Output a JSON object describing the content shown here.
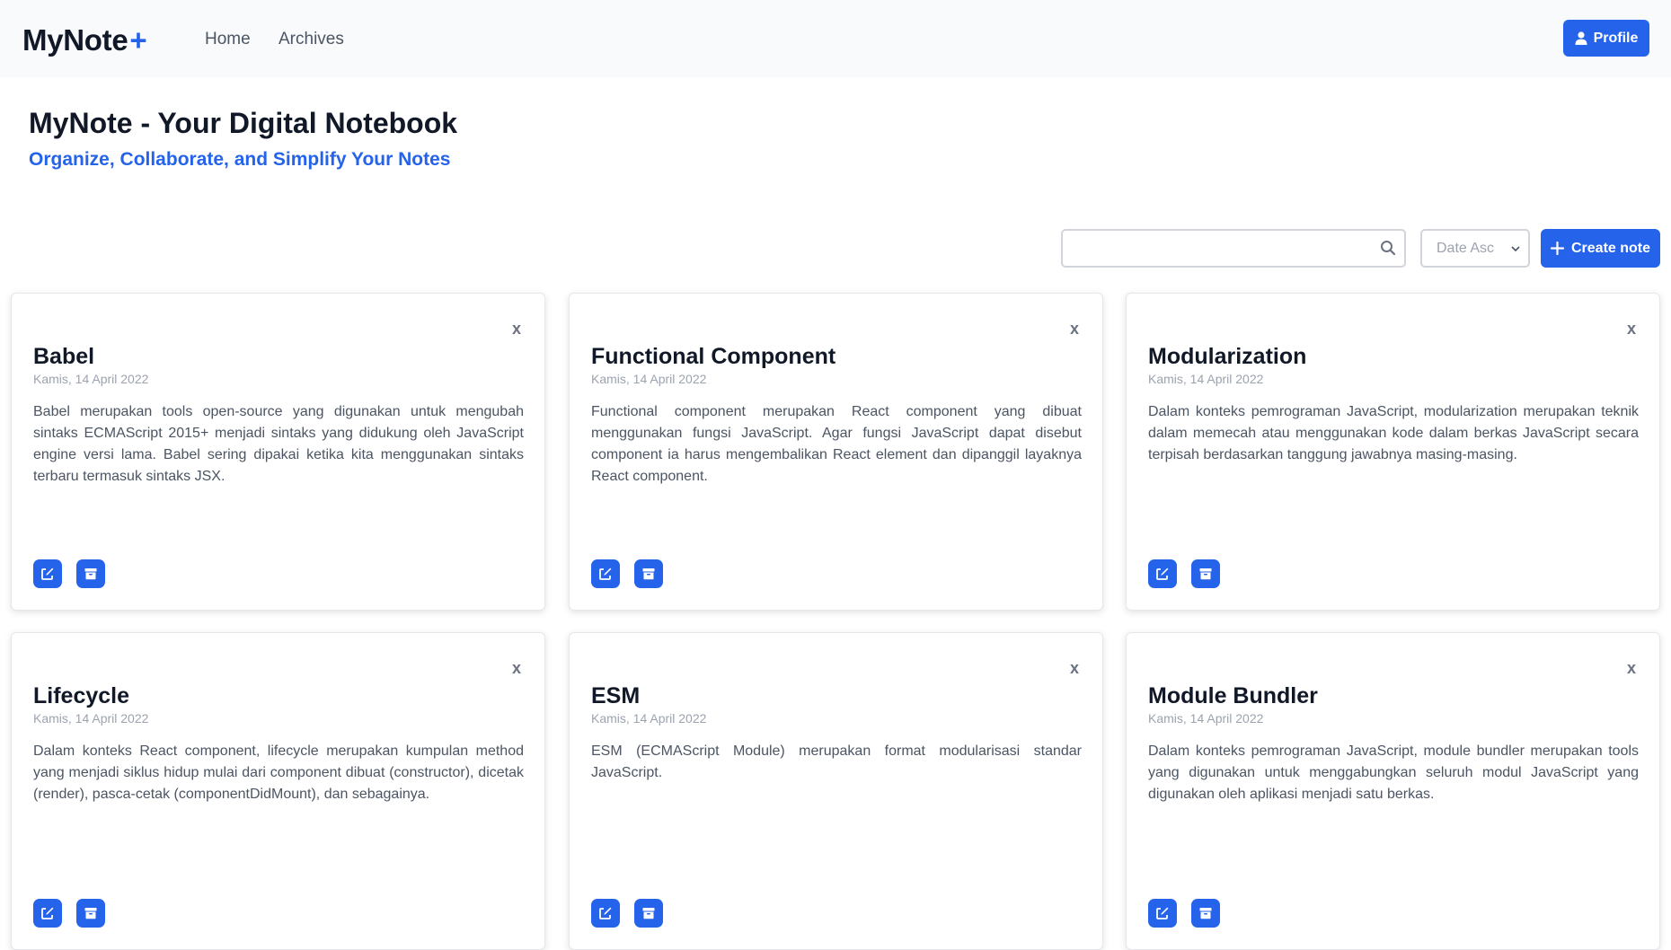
{
  "nav": {
    "brand": "MyNote",
    "brand_plus": "+",
    "links": [
      {
        "label": "Home"
      },
      {
        "label": "Archives"
      }
    ],
    "profile_label": "Profile"
  },
  "hero": {
    "title": "MyNote - Your Digital Notebook",
    "subtitle": "Organize, Collaborate, and Simplify Your Notes"
  },
  "toolbar": {
    "search_value": "",
    "sort_selected": "Date Asc",
    "create_label": "Create note"
  },
  "notes": [
    {
      "title": "Babel",
      "date": "Kamis, 14 April 2022",
      "body": "Babel merupakan tools open-source yang digunakan untuk mengubah sintaks ECMAScript 2015+ menjadi sintaks yang didukung oleh JavaScript engine versi lama. Babel sering dipakai ketika kita menggunakan sintaks terbaru termasuk sintaks JSX."
    },
    {
      "title": "Functional Component",
      "date": "Kamis, 14 April 2022",
      "body": "Functional component merupakan React component yang dibuat menggunakan fungsi JavaScript. Agar fungsi JavaScript dapat disebut component ia harus mengembalikan React element dan dipanggil layaknya React component."
    },
    {
      "title": "Modularization",
      "date": "Kamis, 14 April 2022",
      "body": "Dalam konteks pemrograman JavaScript, modularization merupakan teknik dalam memecah atau menggunakan kode dalam berkas JavaScript secara terpisah berdasarkan tanggung jawabnya masing-masing."
    },
    {
      "title": "Lifecycle",
      "date": "Kamis, 14 April 2022",
      "body": "Dalam konteks React component, lifecycle merupakan kumpulan method yang menjadi siklus hidup mulai dari component dibuat (constructor), dicetak (render), pasca-cetak (componentDidMount), dan sebagainya."
    },
    {
      "title": "ESM",
      "date": "Kamis, 14 April 2022",
      "body": "ESM (ECMAScript Module) merupakan format modularisasi standar JavaScript."
    },
    {
      "title": "Module Bundler",
      "date": "Kamis, 14 April 2022",
      "body": "Dalam konteks pemrograman JavaScript, module bundler merupakan tools yang digunakan untuk menggabungkan seluruh modul JavaScript yang digunakan oleh aplikasi menjadi satu berkas."
    }
  ],
  "card_close_glyph": "x",
  "colors": {
    "accent": "#2563eb",
    "navbar_bg": "#f9fafb",
    "text_muted": "#4b5563",
    "date": "#9ca3af"
  },
  "icons": {
    "search": "search-icon",
    "profile": "user-icon",
    "create": "plus-icon",
    "edit": "edit-icon",
    "archive": "archive-icon",
    "close": "close-icon",
    "sort": "chevron-down-icon"
  }
}
